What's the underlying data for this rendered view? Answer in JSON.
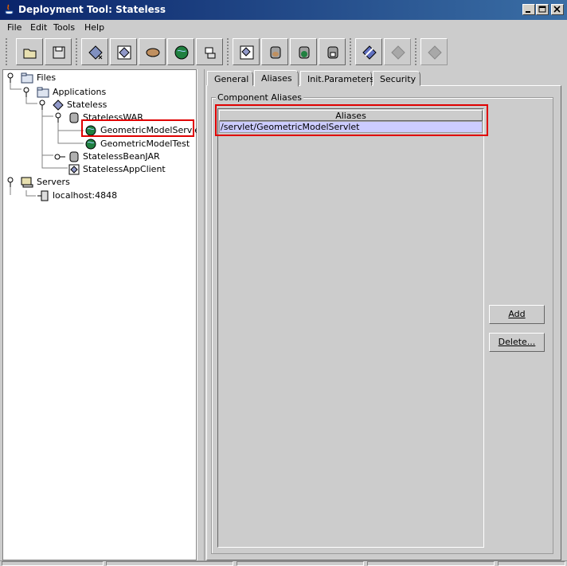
{
  "window": {
    "title": "Deployment Tool: Stateless"
  },
  "menu": {
    "items": [
      {
        "label": "File"
      },
      {
        "label": "Edit"
      },
      {
        "label": "Tools"
      },
      {
        "label": "Help"
      }
    ]
  },
  "toolbar": {
    "buttons": [
      {
        "icon": "open-folder-icon"
      },
      {
        "icon": "save-icon"
      },
      {
        "icon": "new-application-icon"
      },
      {
        "icon": "new-component-icon"
      },
      {
        "icon": "new-bean-icon"
      },
      {
        "icon": "new-web-component-icon"
      },
      {
        "icon": "new-client-icon"
      },
      {
        "icon": "add-application-icon"
      },
      {
        "icon": "add-ejb-jar-icon"
      },
      {
        "icon": "add-war-icon"
      },
      {
        "icon": "add-client-jar-icon"
      },
      {
        "icon": "deploy-icon"
      },
      {
        "icon": "undeploy-icon"
      },
      {
        "icon": "verify-icon"
      }
    ]
  },
  "tree": {
    "nodes": [
      {
        "label": "Files",
        "icon": "folder-icon"
      },
      {
        "label": "Applications",
        "icon": "folder-icon"
      },
      {
        "label": "Stateless",
        "icon": "diamond-app-icon"
      },
      {
        "label": "StatelessWAR",
        "icon": "jar-icon"
      },
      {
        "label": "GeometricModelServlet",
        "icon": "globe-icon",
        "selected": true
      },
      {
        "label": "GeometricModelTest",
        "icon": "globe-icon"
      },
      {
        "label": "StatelessBeanJAR",
        "icon": "jar-icon"
      },
      {
        "label": "StatelessAppClient",
        "icon": "client-icon"
      },
      {
        "label": "Servers",
        "icon": "servers-icon"
      },
      {
        "label": "localhost:4848",
        "icon": "server-icon"
      }
    ]
  },
  "tabs": [
    {
      "label": "General"
    },
    {
      "label": "Aliases",
      "active": true
    },
    {
      "label": "Init.Parameters"
    },
    {
      "label": "Security"
    }
  ],
  "aliases_panel": {
    "group_title": "Component Aliases",
    "column_header": "Aliases",
    "rows": [
      "/servlet/GeometricModelServlet"
    ],
    "add_label": "Add",
    "delete_label": "Delete..."
  },
  "colors": {
    "highlight": "#e00000",
    "selection": "#ccccff",
    "titlebar": "#0a246a"
  }
}
